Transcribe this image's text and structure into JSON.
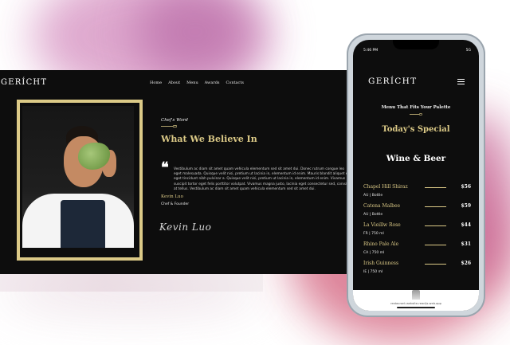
{
  "desktop": {
    "logo": "GERÍCHT",
    "nav": [
      "Home",
      "About",
      "Menu",
      "Awards",
      "Contacts"
    ],
    "chefs_word": {
      "subtitle": "Chef's Word",
      "title": "What We Believe In",
      "quote": "Vestibulum ac diam sit amet quam vehicula elementum sed sit amet dui. Donec rutrum congue leo eget malesuada. Quisque velit nisi, pretium ut lacinia in, elementum id enim. Mauris blandit aliquet elit, eget tincidunt nibh pulvinar a. Quisque velit nisi, pretium ut lacinia in, elementum id enim. Vivamus suscipit tortor eget felis porttitor volutpat. Vivamus magna justo, lacinia eget consectetur sed, convallis at tellus. Vestibulum ac diam sit amet quam vehicula elementum sed sit amet dui.",
      "chef_name": "Kevin Luo",
      "chef_role": "Chef & Founder",
      "signature": "Kevin Luo"
    },
    "accent_color": "#DCCA87"
  },
  "phone": {
    "status_time": "5:46 PM",
    "status_right": "5G",
    "logo": "GERÍCHT",
    "subtitle": "Menu That Fits Your Palette",
    "special": "Today's Special",
    "section": "Wine & Beer",
    "items": [
      {
        "name": "Chapel Hill Shiraz",
        "price": "$56",
        "tags": "AU | Bottle"
      },
      {
        "name": "Catena Malbee",
        "price": "$59",
        "tags": "AU | Bottle"
      },
      {
        "name": "La Vieillw Rose",
        "price": "$44",
        "tags": "FR | 750 ml"
      },
      {
        "name": "Rhino Pale Ale",
        "price": "$31",
        "tags": "CA | 750 ml"
      },
      {
        "name": "Irish Guinness",
        "price": "$26",
        "tags": "IE | 750 ml"
      }
    ],
    "url": "restaurant-website-reactjs.web.app"
  }
}
